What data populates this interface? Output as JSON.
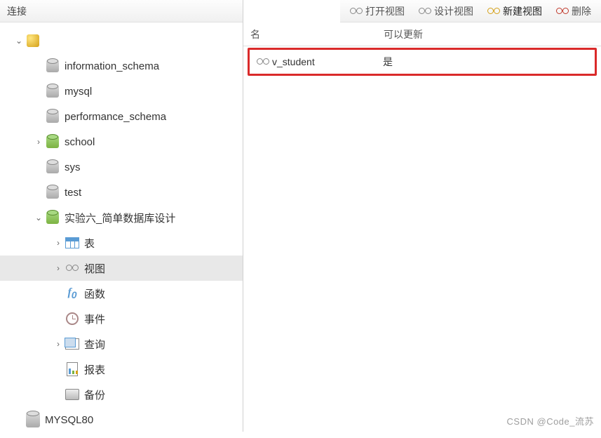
{
  "sidebar": {
    "title": "连接",
    "connection_name": "",
    "databases": [
      {
        "name": "information_schema",
        "active": false
      },
      {
        "name": "mysql",
        "active": false
      },
      {
        "name": "performance_schema",
        "active": false
      },
      {
        "name": "school",
        "active": true,
        "expandable": true
      },
      {
        "name": "sys",
        "active": false
      },
      {
        "name": "test",
        "active": false
      },
      {
        "name": "实验六_简单数据库设计",
        "active": true,
        "expanded": true
      }
    ],
    "folders": {
      "tables": "表",
      "views": "视图",
      "functions": "函数",
      "events": "事件",
      "queries": "查询",
      "reports": "报表",
      "backups": "备份"
    },
    "connection2": "MYSQL80"
  },
  "toolbar": {
    "open_view": "打开视图",
    "design_view": "设计视图",
    "new_view": "新建视图",
    "delete": "删除"
  },
  "main": {
    "columns": {
      "name": "名",
      "updatable": "可以更新"
    },
    "rows": [
      {
        "name": "v_student",
        "updatable": "是"
      }
    ]
  },
  "watermark": "CSDN @Code_流苏"
}
